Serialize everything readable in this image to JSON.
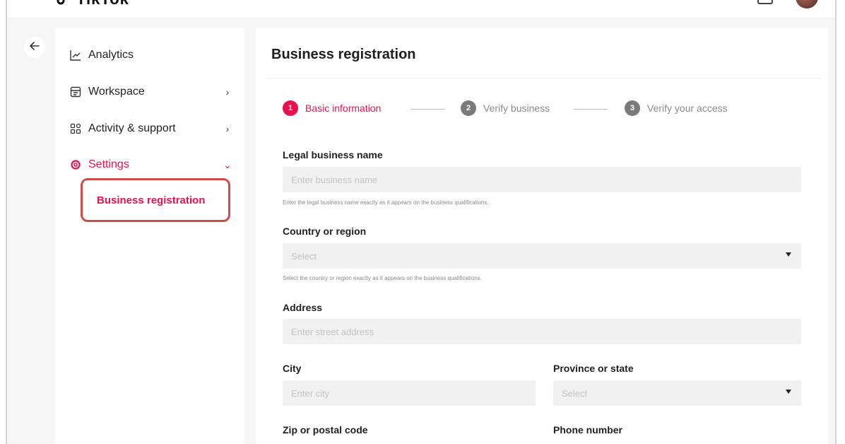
{
  "app": {
    "logo_text": "TikTok"
  },
  "sidebar": {
    "items": [
      {
        "label": "Analytics",
        "chevron": ""
      },
      {
        "label": "Workspace",
        "chevron": "›"
      },
      {
        "label": "Activity & support",
        "chevron": "›"
      },
      {
        "label": "Settings",
        "chevron": "⌄"
      }
    ],
    "active_sub_item": "Business registration"
  },
  "main": {
    "title": "Business registration",
    "steps": [
      {
        "number": "1",
        "label": "Basic information",
        "state": "active"
      },
      {
        "number": "2",
        "label": "Verify business",
        "state": "inactive"
      },
      {
        "number": "3",
        "label": "Verify your access",
        "state": "inactive"
      }
    ],
    "form": {
      "legal_name": {
        "label": "Legal business name",
        "placeholder": "Enter business name",
        "help": "Enter the legal business name exactly as it appears on the business qualifications."
      },
      "country": {
        "label": "Country or region",
        "placeholder": "Select",
        "help": "Select the country or region exactly as it appears on the business qualifications."
      },
      "address": {
        "label": "Address",
        "placeholder": "Enter street address"
      },
      "city": {
        "label": "City",
        "placeholder": "Enter city"
      },
      "province": {
        "label": "Province or state",
        "placeholder": "Select"
      },
      "zip": {
        "label": "Zip or postal code"
      },
      "phone": {
        "label": "Phone number"
      }
    }
  },
  "colors": {
    "accent": "#e8114e",
    "highlight_border": "#cc4d4a",
    "step_inactive": "#7a7a7a",
    "input_bg": "#f1f1f2"
  },
  "icons": {
    "back": "arrow-left-icon",
    "analytics": "chart-line-icon",
    "workspace": "calendar-icon",
    "activity": "grid-icon",
    "settings": "settings-gear-icon"
  }
}
